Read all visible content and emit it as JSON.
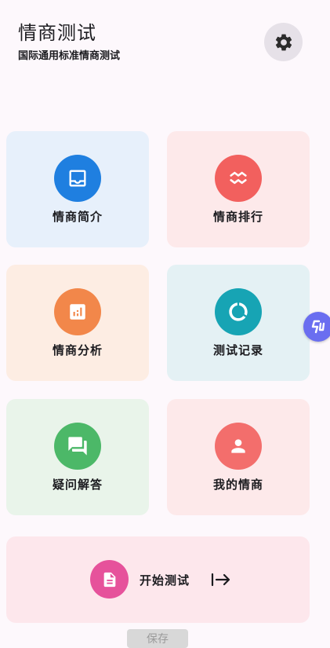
{
  "header": {
    "title": "情商测试",
    "subtitle": "国际通用标准情商测试",
    "settings_icon": "gear-icon"
  },
  "cards": [
    {
      "label": "情商简介",
      "icon": "inbox-icon",
      "bg": "#e7f0fb",
      "accent": "#1f7fe0"
    },
    {
      "label": "情商排行",
      "icon": "trend-icon",
      "bg": "#fde9ea",
      "accent": "#f2605e"
    },
    {
      "label": "情商分析",
      "icon": "bar-chart-icon",
      "bg": "#fdede3",
      "accent": "#f2874a"
    },
    {
      "label": "测试记录",
      "icon": "donut-icon",
      "bg": "#e4f1f4",
      "accent": "#17a4b4"
    },
    {
      "label": "疑问解答",
      "icon": "chat-icon",
      "bg": "#e9f4ea",
      "accent": "#4cb868"
    },
    {
      "label": "我的情商",
      "icon": "person-icon",
      "bg": "#fde9ea",
      "accent": "#f36e6c"
    }
  ],
  "start": {
    "label": "开始测试",
    "icon": "document-icon",
    "arrow_icon": "arrow-right-to-bar-icon",
    "bg": "#fde7ec",
    "accent": "#e6529b"
  },
  "floating_button": {
    "icon": "assistant-logo-icon",
    "color": "#6a6ef0"
  },
  "save_button": {
    "label": "保存"
  }
}
